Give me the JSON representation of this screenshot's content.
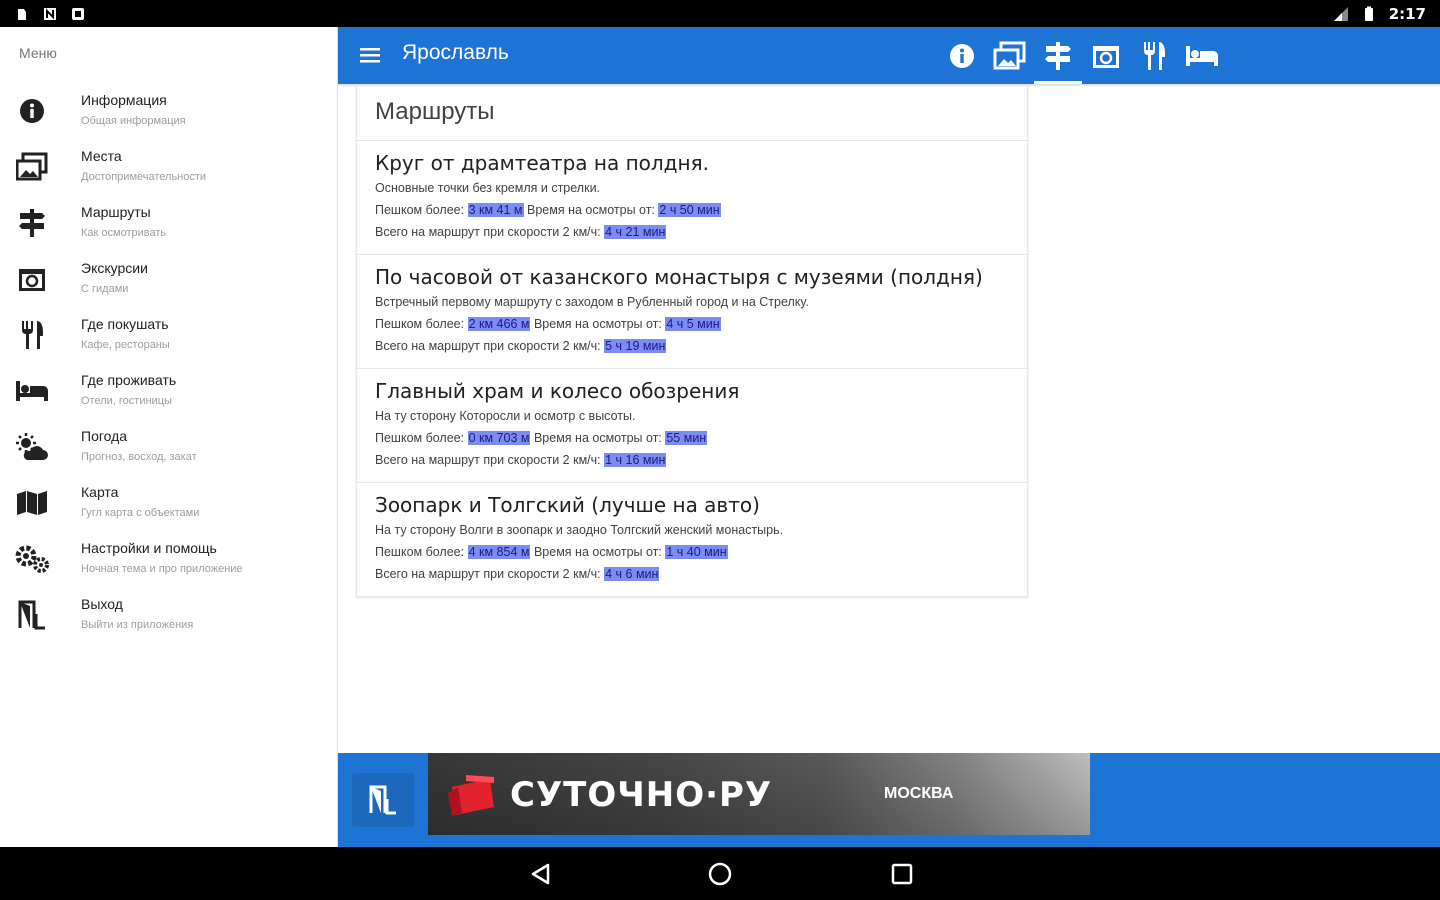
{
  "status_bar": {
    "time": "2:17"
  },
  "drawer": {
    "title": "Меню",
    "items": [
      {
        "label": "Информация",
        "sub": "Общая информация",
        "icon": "info-icon"
      },
      {
        "label": "Места",
        "sub": "Достопримечательности",
        "icon": "photos-icon"
      },
      {
        "label": "Маршруты",
        "sub": "Как осмотривать",
        "icon": "signpost-icon"
      },
      {
        "label": "Экскурсии",
        "sub": "С гидами",
        "icon": "tour-icon"
      },
      {
        "label": "Где покушать",
        "sub": "Кафе, рестораны",
        "icon": "restaurant-icon"
      },
      {
        "label": "Где проживать",
        "sub": "Отели, гостиницы",
        "icon": "hotel-icon"
      },
      {
        "label": "Погода",
        "sub": "Прогноз, восход, закат",
        "icon": "weather-icon"
      },
      {
        "label": "Карта",
        "sub": "Гугл карта с объектами",
        "icon": "map-icon"
      },
      {
        "label": "Настройки и помощь",
        "sub": "Ночная тема и про приложение",
        "icon": "settings-icon"
      },
      {
        "label": "Выход",
        "sub": "Выйти из приложения",
        "icon": "exit-icon"
      }
    ]
  },
  "appbar": {
    "title": "Ярославль",
    "tabs": [
      "info-icon",
      "photos-icon",
      "signpost-icon",
      "tour-icon",
      "restaurant-icon",
      "hotel-icon"
    ],
    "active_tab": "signpost-icon"
  },
  "content": {
    "header": "Маршруты",
    "routes": [
      {
        "title": "Круг от драмтеатра на полдня.",
        "desc": "Основные точки без кремля и стрелки.",
        "walk_label": "Пешком более:",
        "walk_value": "3 км 41 м",
        "view_label": "Время на осмотры от:",
        "view_value": "2 ч 50 мин",
        "total_label": "Всего на маршрут при скорости 2 км/ч:",
        "total_value": "4 ч 21 мин"
      },
      {
        "title": "По часовой от казанского монастыря с музеями (полдня)",
        "desc": "Встречный первому маршруту с заходом в Рубленный город и на Стрелку.",
        "walk_label": "Пешком более:",
        "walk_value": "2 км 466 м",
        "view_label": "Время на осмотры от:",
        "view_value": "4 ч 5 мин",
        "total_label": "Всего на маршрут при скорости 2 км/ч:",
        "total_value": "5 ч 19 мин"
      },
      {
        "title": "Главный храм и колесо обозрения",
        "desc": "На ту сторону Которосли и осмотр с высоты.",
        "walk_label": "Пешком более:",
        "walk_value": "0 км 703 м",
        "view_label": "Время на осмотры от:",
        "view_value": "55 мин",
        "total_label": "Всего на маршрут при скорости 2 км/ч:",
        "total_value": "1 ч 16 мин"
      },
      {
        "title": "Зоопарк и Толгский (лучше на авто)",
        "desc": "На ту сторону Волги в зоопарк и заодно Толгский женский монастырь.",
        "walk_label": "Пешком более:",
        "walk_value": "4 км 854 м",
        "view_label": "Время на осмотры от:",
        "view_value": "1 ч 40 мин",
        "total_label": "Всего на маршрут при скорости 2 км/ч:",
        "total_value": "4 ч 6 мин"
      }
    ]
  },
  "ad": {
    "brand": "СУТОЧНО·РУ",
    "city": "МОСКВА"
  },
  "colors": {
    "accent": "#1e74d4",
    "highlight": "#7b8df5"
  }
}
